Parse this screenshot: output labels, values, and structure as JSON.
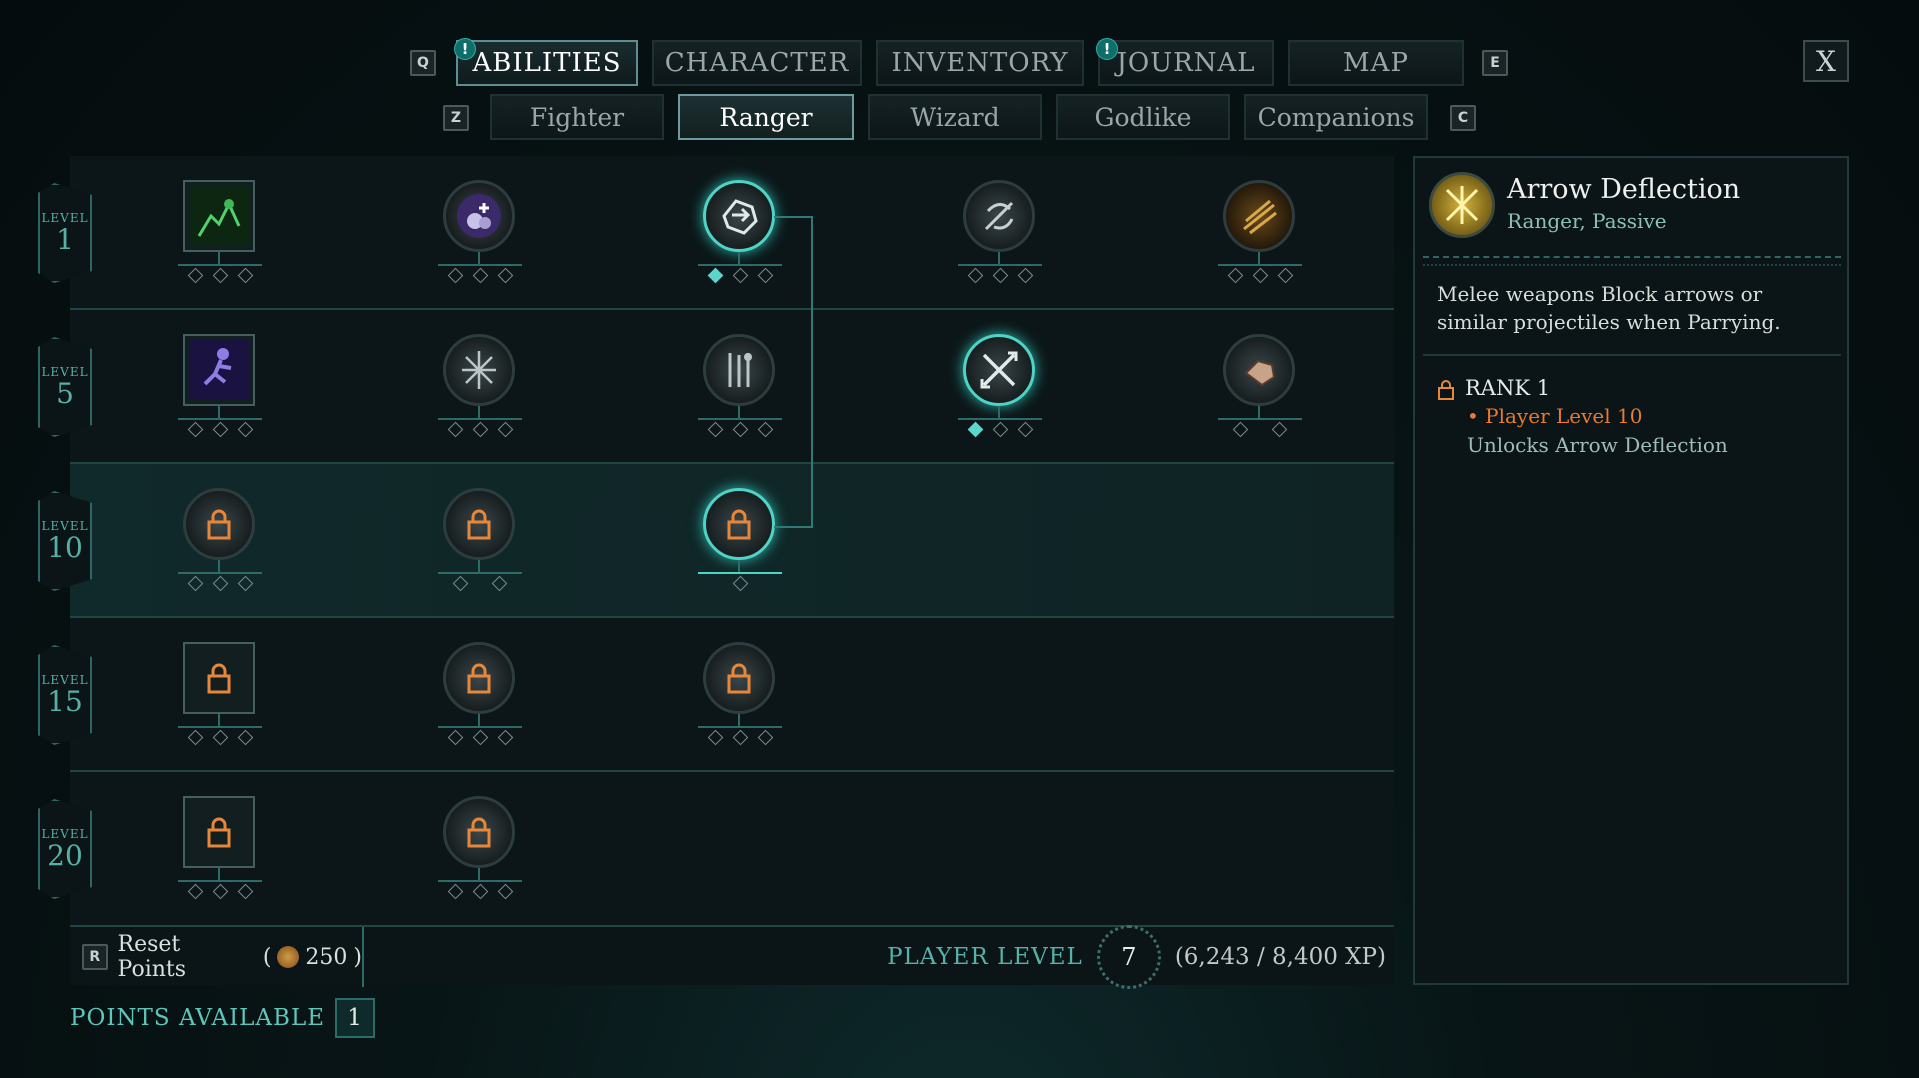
{
  "top_tabs": {
    "left_key": "Q",
    "right_key": "E",
    "items": [
      {
        "label": "ABILITIES",
        "active": true,
        "notice": "!"
      },
      {
        "label": "CHARACTER",
        "active": false
      },
      {
        "label": "INVENTORY",
        "active": false
      },
      {
        "label": "JOURNAL",
        "active": false,
        "notice": "!"
      },
      {
        "label": "MAP",
        "active": false
      }
    ],
    "close_label": "X"
  },
  "sub_tabs": {
    "left_key": "Z",
    "right_key": "C",
    "items": [
      {
        "label": "Fighter"
      },
      {
        "label": "Ranger",
        "active": true
      },
      {
        "label": "Wizard"
      },
      {
        "label": "Godlike"
      },
      {
        "label": "Companions"
      }
    ]
  },
  "tree": {
    "level_word": "LEVEL",
    "levels": [
      "1",
      "5",
      "10",
      "15",
      "20"
    ]
  },
  "reset": {
    "key": "R",
    "label": "Reset Points",
    "cost": "250"
  },
  "player": {
    "label": "PLAYER LEVEL",
    "level": "7",
    "xp": "(6,243 / 8,400 XP)"
  },
  "points": {
    "label": "POINTS AVAILABLE",
    "value": "1"
  },
  "detail": {
    "title": "Arrow Deflection",
    "subtitle": "Ranger, Passive",
    "description": "Melee weapons Block arrows or similar projectiles when Parrying.",
    "rank_label": "RANK 1",
    "requirement": "• Player Level 10",
    "unlock_text": "Unlocks Arrow Deflection"
  },
  "colors": {
    "accent": "#5bd6cc",
    "requirement": "#e87a31",
    "level_text": "#56b1a8"
  }
}
